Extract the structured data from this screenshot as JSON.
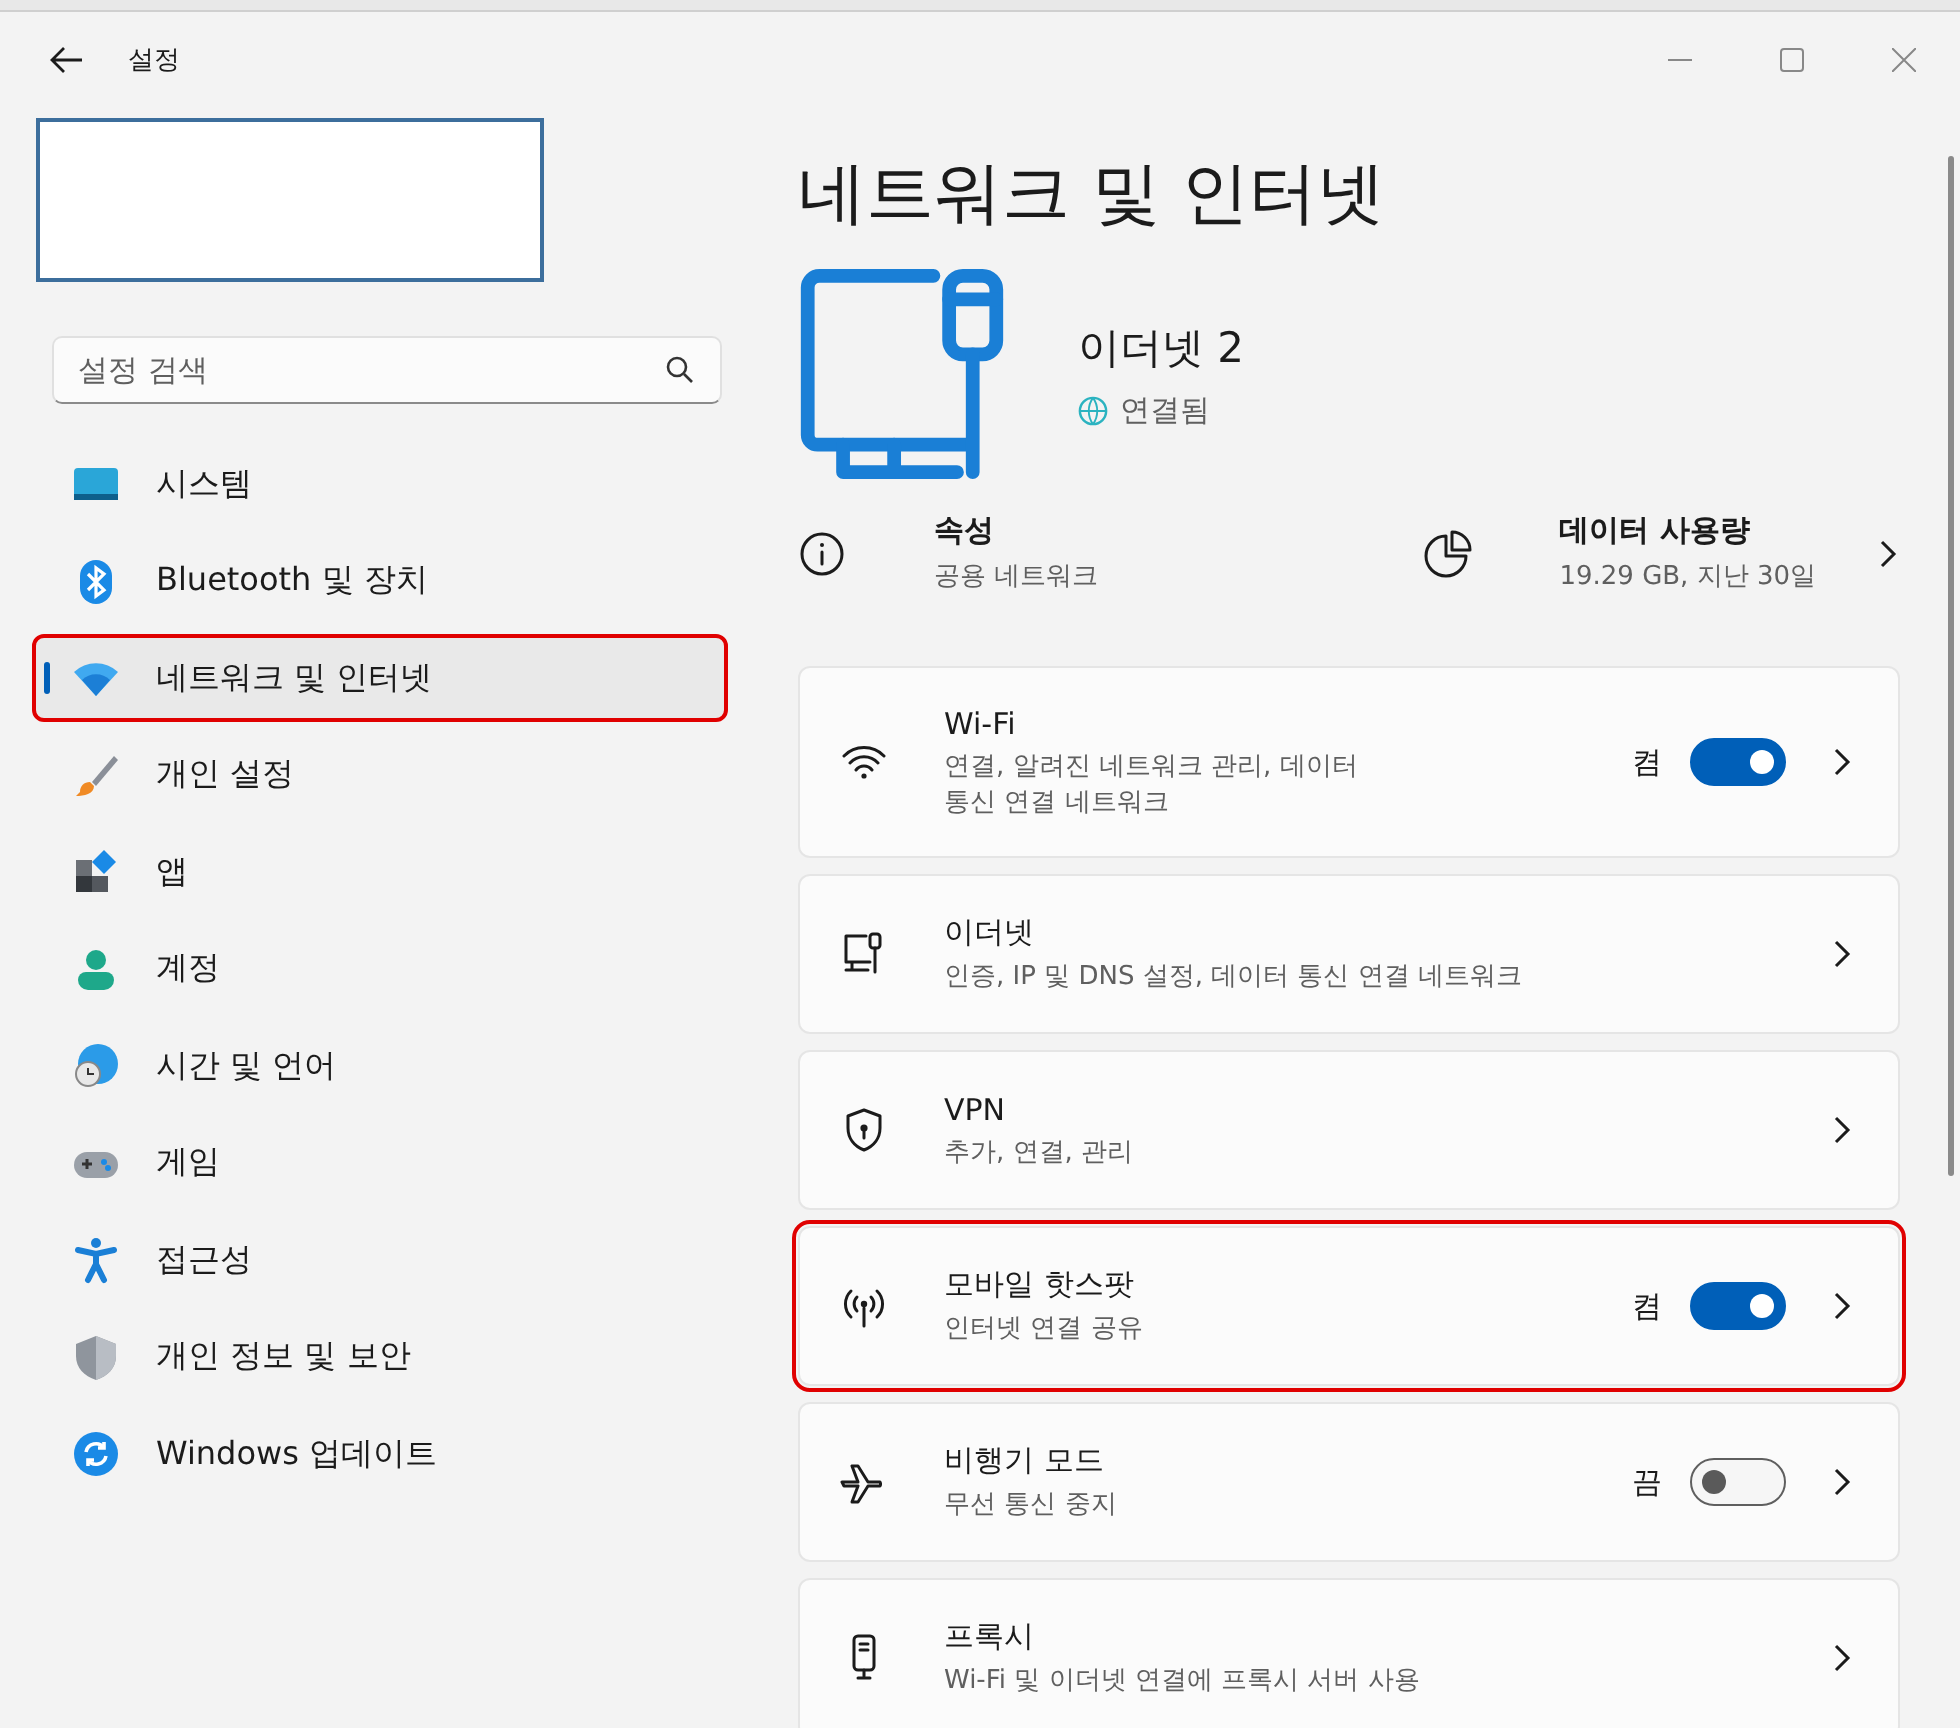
{
  "window": {
    "title": "설정"
  },
  "search": {
    "placeholder": "설정 검색"
  },
  "sidebar": {
    "items": [
      {
        "label": "시스템",
        "selected": false,
        "annotated": false
      },
      {
        "label": "Bluetooth 및 장치",
        "selected": false,
        "annotated": false
      },
      {
        "label": "네트워크 및 인터넷",
        "selected": true,
        "annotated": true
      },
      {
        "label": "개인 설정",
        "selected": false,
        "annotated": false
      },
      {
        "label": "앱",
        "selected": false,
        "annotated": false
      },
      {
        "label": "계정",
        "selected": false,
        "annotated": false
      },
      {
        "label": "시간 및 언어",
        "selected": false,
        "annotated": false
      },
      {
        "label": "게임",
        "selected": false,
        "annotated": false
      },
      {
        "label": "접근성",
        "selected": false,
        "annotated": false
      },
      {
        "label": "개인 정보 및 보안",
        "selected": false,
        "annotated": false
      },
      {
        "label": "Windows 업데이트",
        "selected": false,
        "annotated": false
      }
    ]
  },
  "page": {
    "title": "네트워크 및 인터넷"
  },
  "connection": {
    "name": "이더넷 2",
    "status": "연결됨"
  },
  "summary": [
    {
      "kind": "info",
      "title": "속성",
      "subtitle": "공용 네트워크"
    },
    {
      "kind": "usage",
      "title": "데이터 사용량",
      "subtitle": "19.29 GB, 지난 30일"
    }
  ],
  "cards": [
    {
      "title": "Wi-Fi",
      "subtitle": "연결, 알려진 네트워크 관리, 데이터 통신 연결 네트워크",
      "toggle": {
        "label": "켬",
        "on": true
      },
      "annotated": false
    },
    {
      "title": "이더넷",
      "subtitle": "인증, IP 및 DNS 설정, 데이터 통신 연결 네트워크",
      "annotated": false
    },
    {
      "title": "VPN",
      "subtitle": "추가, 연결, 관리",
      "annotated": false
    },
    {
      "title": "모바일 핫스팟",
      "subtitle": "인터넷 연결 공유",
      "toggle": {
        "label": "켬",
        "on": true
      },
      "annotated": true
    },
    {
      "title": "비행기 모드",
      "subtitle": "무선 통신 중지",
      "toggle": {
        "label": "끔",
        "on": false
      },
      "annotated": false
    },
    {
      "title": "프록시",
      "subtitle": "Wi-Fi 및 이더넷 연결에 프록시 서버 사용",
      "annotated": false
    }
  ]
}
